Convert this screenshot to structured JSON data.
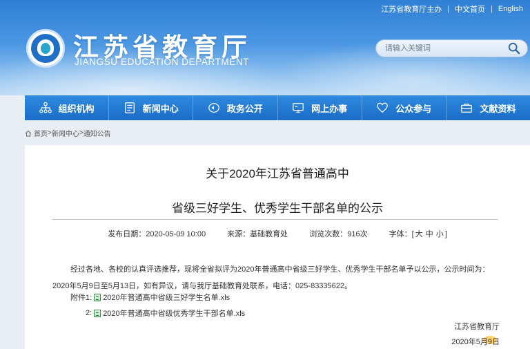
{
  "toplinks": {
    "sponsor": "江苏省教育厅主办",
    "chinese": "中文首页",
    "english": "English"
  },
  "logo": {
    "cn": "江苏省教育厅",
    "en": "JIANGSU EDUCATION DEPARTMENT"
  },
  "search": {
    "placeholder": "请输入关键词",
    "icon": "search-icon"
  },
  "nav": [
    {
      "label": "组织机构",
      "icon": "org-chart-icon"
    },
    {
      "label": "新闻中心",
      "icon": "news-icon"
    },
    {
      "label": "政务公开",
      "icon": "eye-icon"
    },
    {
      "label": "网上办事",
      "icon": "monitor-icon"
    },
    {
      "label": "公众参与",
      "icon": "heart-icon"
    },
    {
      "label": "文献资料",
      "icon": "briefcase-icon"
    }
  ],
  "breadcrumb": {
    "home": "首页",
    "news": "新闻中心",
    "notice": "通知公告",
    "sep": ">"
  },
  "article": {
    "title_line1": "关于2020年江苏省普通高中",
    "title_line2": "省级三好学生、优秀学生干部名单的公示",
    "publish_label": "发布日期：",
    "publish_date": "2020-05-09 10:00",
    "source_label": "来源：",
    "source": "基础教育处",
    "views_label": "浏览次数：",
    "views": "916次",
    "font_label": "字体：",
    "font_open": "[",
    "font_large": "大",
    "font_medium": "中",
    "font_small": "小",
    "font_close": "]",
    "paragraph": "经过各地、各校的认真评选推荐，现将全省拟评为2020年普通高中省级三好学生、优秀学生干部名单予以公示，公示时间为：2020年5月9日至5月13日，如有异议，请与我厅基础教育处联系，电话：025-83335622。",
    "attach_label1": "附件1:",
    "attach_file1": "2020年普通高中省级三好学生名单.xls",
    "attach_label2": "2:",
    "attach_file2": "2020年普通高中省级优秀学生干部名单.xls",
    "signature": "江苏省教育厅",
    "sign_date": "2020年5月9日"
  },
  "colors": {
    "nav_bg": "#1f72cc",
    "header_top": "#2f7fd6"
  }
}
